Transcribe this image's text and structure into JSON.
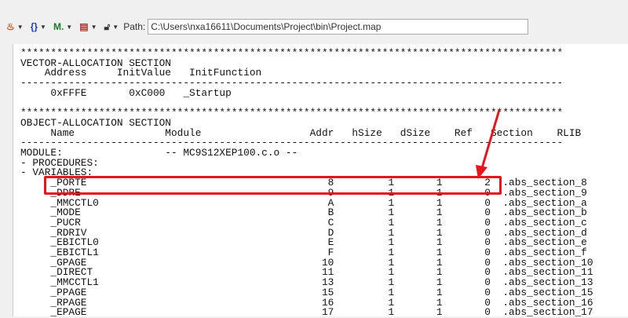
{
  "toolbar": {
    "path_label": "Path:",
    "path_value": "C:\\Users\\nxa16611\\Documents\\Project\\bin\\Project.map"
  },
  "vector": {
    "title": "VECTOR-ALLOCATION SECTION",
    "headers": [
      "Address",
      "InitValue",
      "InitFunction"
    ],
    "row": [
      "0xFFFE",
      "0xC000",
      "_Startup"
    ]
  },
  "object": {
    "title": "OBJECT-ALLOCATION SECTION",
    "headers": [
      "Name",
      "Module",
      "Addr",
      "hSize",
      "dSize",
      "Ref",
      "Section",
      "RLIB"
    ],
    "module_label": "MODULE:",
    "module_name": "-- MC9S12XEP100.c.o --",
    "procedures": "- PROCEDURES:",
    "variables": "- VARIABLES:",
    "rows": [
      [
        "_PORTE",
        "8",
        "1",
        "1",
        "2",
        ".abs_section_8"
      ],
      [
        "_DDRE",
        "9",
        "1",
        "1",
        "0",
        ".abs_section_9"
      ],
      [
        "_MMCCTL0",
        "A",
        "1",
        "1",
        "0",
        ".abs_section_a"
      ],
      [
        "_MODE",
        "B",
        "1",
        "1",
        "0",
        ".abs_section_b"
      ],
      [
        "_PUCR",
        "C",
        "1",
        "1",
        "0",
        ".abs_section_c"
      ],
      [
        "_RDRIV",
        "D",
        "1",
        "1",
        "0",
        ".abs_section_d"
      ],
      [
        "_EBICTL0",
        "E",
        "1",
        "1",
        "0",
        ".abs_section_e"
      ],
      [
        "_EBICTL1",
        "F",
        "1",
        "1",
        "0",
        ".abs_section_f"
      ],
      [
        "_GPAGE",
        "10",
        "1",
        "1",
        "0",
        ".abs_section_10"
      ],
      [
        "_DIRECT",
        "11",
        "1",
        "1",
        "0",
        ".abs_section_11"
      ],
      [
        "_MMCCTL1",
        "13",
        "1",
        "1",
        "0",
        ".abs_section_13"
      ],
      [
        "_PPAGE",
        "15",
        "1",
        "1",
        "0",
        ".abs_section_15"
      ],
      [
        "_RPAGE",
        "16",
        "1",
        "1",
        "0",
        ".abs_section_16"
      ],
      [
        "_EPAGE",
        "17",
        "1",
        "1",
        "0",
        ".abs_section_17"
      ]
    ]
  },
  "colors": {
    "highlight": "#e8141c"
  }
}
